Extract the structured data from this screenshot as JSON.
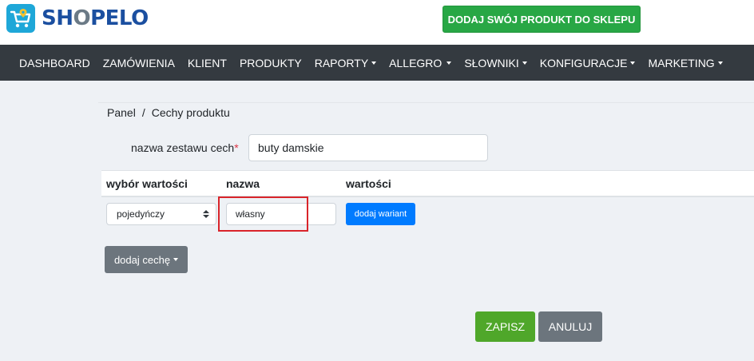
{
  "header": {
    "logo": {
      "prefix": "SH",
      "o": "O",
      "suffix": "PELO"
    },
    "add_product_label": "DODAJ SWÓJ PRODUKT DO SKLEPU",
    "colors": {
      "brand": "#1b4fa0",
      "accent_green": "#28a745"
    }
  },
  "nav": {
    "items": [
      {
        "label": "DASHBOARD",
        "dropdown": false
      },
      {
        "label": "ZAMÓWIENIA",
        "dropdown": false
      },
      {
        "label": "KLIENT",
        "dropdown": false
      },
      {
        "label": "PRODUKTY",
        "dropdown": false
      },
      {
        "label": "RAPORTY",
        "dropdown": true
      },
      {
        "label": "ALLEGRO",
        "dropdown": true
      },
      {
        "label": "SŁOWNIKI",
        "dropdown": true
      },
      {
        "label": "KONFIGURACJE",
        "dropdown": true
      },
      {
        "label": "MARKETING",
        "dropdown": true
      }
    ]
  },
  "breadcrumb": {
    "root": "Panel",
    "separator": "/",
    "current": "Cechy produktu"
  },
  "form": {
    "set_name_label": "nazwa zestawu cech",
    "required_mark": "*",
    "set_name_value": "buty damskie"
  },
  "table": {
    "headers": {
      "choice": "wybór wartości",
      "name": "nazwa",
      "values": "wartości"
    },
    "row": {
      "choice_value": "pojedyńczy",
      "name_value": "własny",
      "add_variant_label": "dodaj wariant"
    }
  },
  "actions": {
    "add_feature_label": "dodaj cechę",
    "save_label": "ZAPISZ",
    "cancel_label": "ANULUJ"
  }
}
